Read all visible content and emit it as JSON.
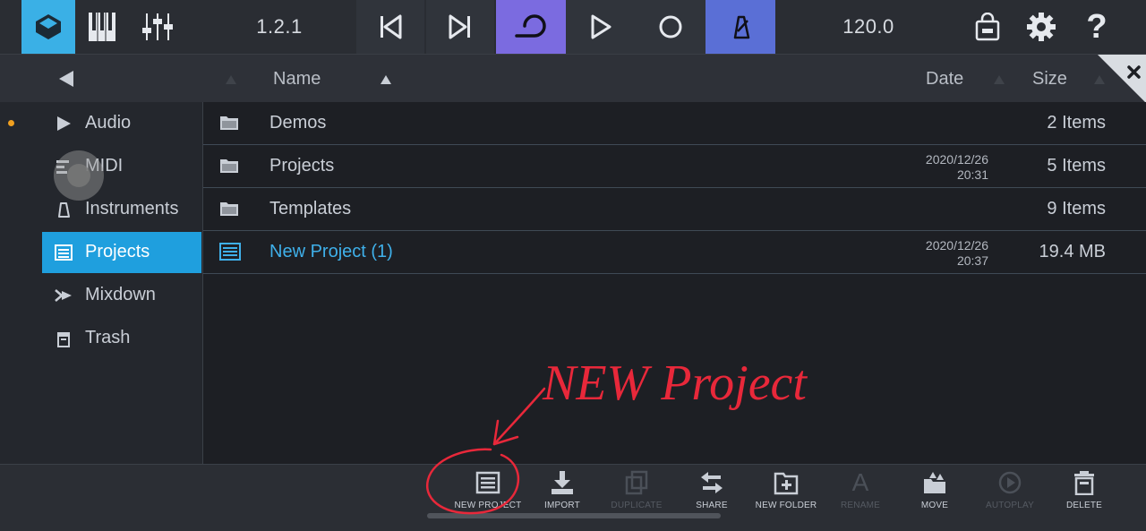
{
  "topbar": {
    "version": "1.2.1",
    "tempo": "120.0"
  },
  "header": {
    "col_name": "Name",
    "col_date": "Date",
    "col_size": "Size"
  },
  "sidebar": {
    "items": [
      {
        "label": "Audio"
      },
      {
        "label": "MIDI"
      },
      {
        "label": "Instruments"
      },
      {
        "label": "Projects"
      },
      {
        "label": "Mixdown"
      },
      {
        "label": "Trash"
      }
    ]
  },
  "files": [
    {
      "name": "Demos",
      "date": "",
      "time": "",
      "size": "2 Items"
    },
    {
      "name": "Projects",
      "date": "2020/12/26",
      "time": "20:31",
      "size": "5 Items"
    },
    {
      "name": "Templates",
      "date": "",
      "time": "",
      "size": "9 Items"
    },
    {
      "name": "New Project (1)",
      "date": "2020/12/26",
      "time": "20:37",
      "size": "19.4 MB"
    }
  ],
  "toolbar": {
    "new_project": "NEW PROJECT",
    "import": "IMPORT",
    "duplicate": "DUPLICATE",
    "share": "SHARE",
    "new_folder": "NEW FOLDER",
    "rename": "RENAME",
    "move": "MOVE",
    "autoplay": "AUTOPLAY",
    "delete": "DELETE"
  },
  "annotation": {
    "text": "NEW Project"
  },
  "colors": {
    "accent_blue": "#1f9fde",
    "loop_purple": "#7b6be0",
    "metronome_blue": "#5a6fd6",
    "annotation_red": "#e8283a",
    "audio_dot": "#f0a020"
  }
}
